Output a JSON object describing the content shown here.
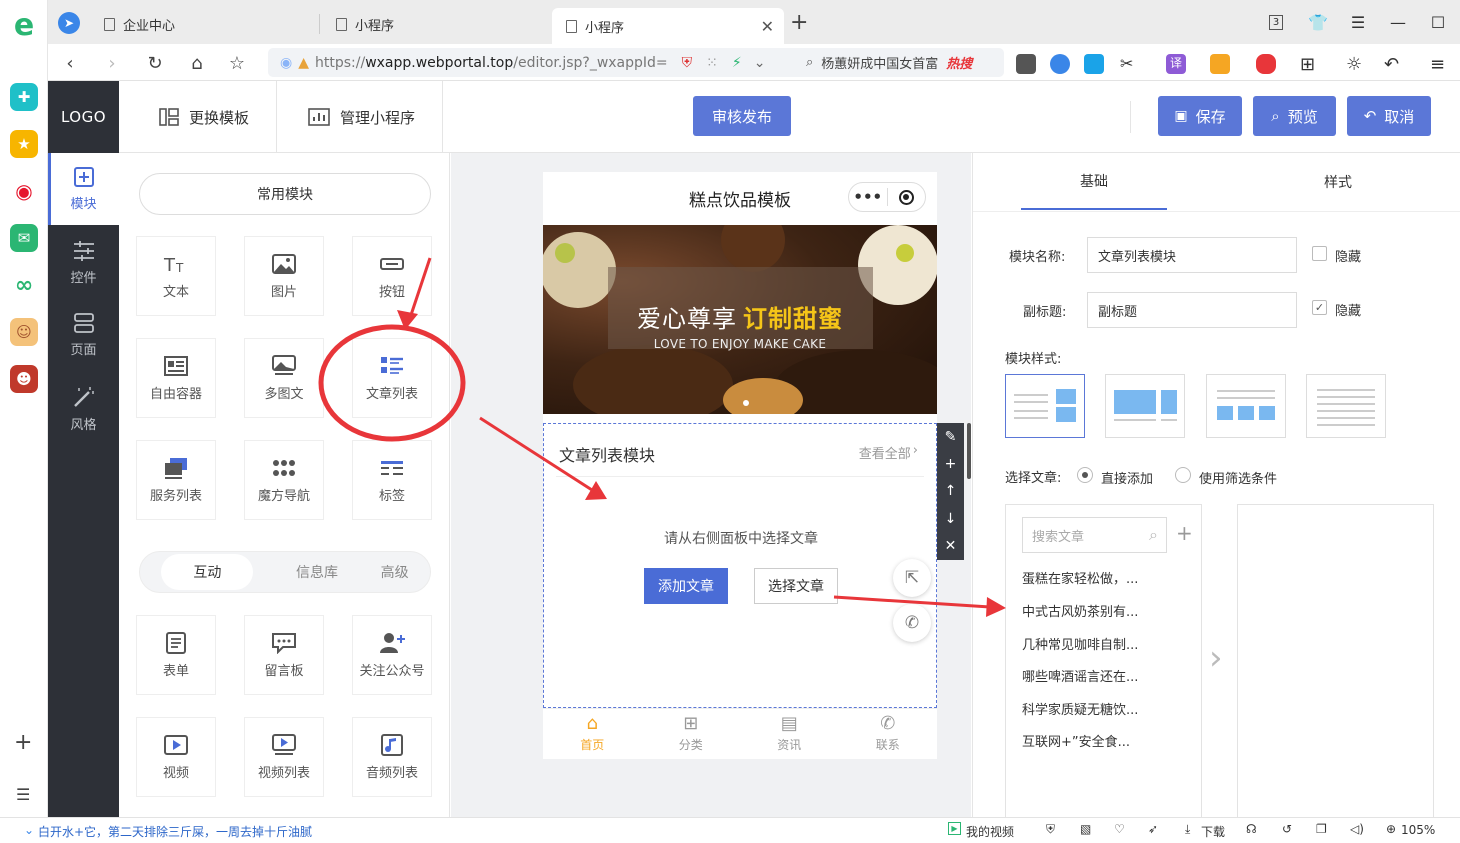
{
  "browser": {
    "tabs": [
      {
        "label": "企业中心"
      },
      {
        "label": "小程序"
      },
      {
        "label": "小程序"
      }
    ],
    "tab_count": "3",
    "url_scheme": "https://",
    "url_host": "wxapp.webportal.top",
    "url_path": "/editor.jsp?_wxappId=",
    "search_text": "杨蕙妍成中国女首富",
    "search_hot": "热搜"
  },
  "header": {
    "logo": "LOGO",
    "change_template": "更换模板",
    "manage_app": "管理小程序",
    "publish": "审核发布",
    "save": "保存",
    "preview": "预览",
    "cancel": "取消"
  },
  "sidebar": {
    "items": [
      {
        "label": "模块"
      },
      {
        "label": "控件"
      },
      {
        "label": "页面"
      },
      {
        "label": "风格"
      }
    ]
  },
  "modules": {
    "common_label": "常用模块",
    "common": [
      "文本",
      "图片",
      "按钮",
      "自由容器",
      "多图文",
      "文章列表",
      "服务列表",
      "魔方导航",
      "标签"
    ],
    "tabs": [
      "互动",
      "信息库",
      "高级"
    ],
    "interactive": [
      "表单",
      "留言板",
      "关注公众号",
      "视频",
      "视频列表",
      "音频列表"
    ]
  },
  "phone": {
    "title": "糕点饮品模板",
    "banner_cn1": "爱心尊享",
    "banner_cn2": "订制甜蜜",
    "banner_en": "LOVE TO ENJOY MAKE CAKE",
    "module_title": "文章列表模块",
    "view_all": "查看全部",
    "empty_hint": "请从右侧面板中选择文章",
    "add_article": "添加文章",
    "select_article": "选择文章",
    "tabbar": [
      "首页",
      "分类",
      "资讯",
      "联系"
    ]
  },
  "right_panel": {
    "tabs": [
      "基础",
      "样式"
    ],
    "module_name_label": "模块名称:",
    "module_name_value": "文章列表模块",
    "hide_label": "隐藏",
    "subtitle_label": "副标题:",
    "subtitle_value": "副标题",
    "hide2_label": "隐藏",
    "style_label": "模块样式:",
    "select_article_label": "选择文章:",
    "option_direct": "直接添加",
    "option_filter": "使用筛选条件",
    "search_placeholder": "搜索文章",
    "articles": [
      "蛋糕在家轻松做，...",
      "中式古风奶茶别有...",
      "几种常见咖啡自制...",
      "哪些啤酒谣言还在...",
      "科学家质疑无糖饮...",
      "互联网+”安全食..."
    ]
  },
  "status": {
    "news": "白开水+它，第二天排除三斤屎，一周去掉十斤油腻",
    "my_video": "我的视频",
    "download": "下载",
    "zoom": "105%"
  },
  "colors": {
    "accent": "#5b77d7",
    "dark_sidebar": "#2d3037",
    "arrow_red": "#e8363a",
    "tab_orange": "#f5a623"
  }
}
